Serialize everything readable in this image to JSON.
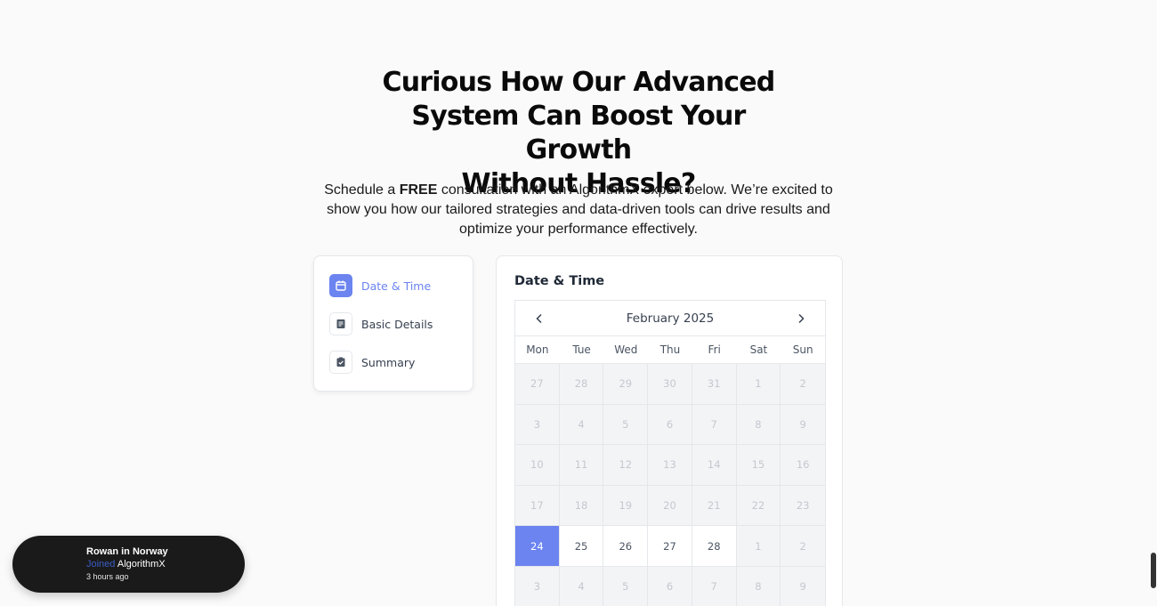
{
  "hero": {
    "title_lines": [
      "Curious How Our Advanced",
      "System Can Boost Your Growth",
      "Without Hassle?"
    ],
    "subtitle_pre": "Schedule a ",
    "subtitle_bold": "FREE",
    "subtitle_post": " consultation with an AlgorithmX expert below. We’re excited to show you how our tailored strategies and data-driven tools can drive results and optimize your performance effectively."
  },
  "steps": [
    {
      "label": "Date & Time",
      "icon": "calendar-icon",
      "active": true
    },
    {
      "label": "Basic Details",
      "icon": "document-icon",
      "active": false
    },
    {
      "label": "Summary",
      "icon": "clipboard-check-icon",
      "active": false
    }
  ],
  "calendar": {
    "title": "Date & Time",
    "month": "February 2025",
    "weekdays": [
      "Mon",
      "Tue",
      "Wed",
      "Thu",
      "Fri",
      "Sat",
      "Sun"
    ],
    "days": [
      {
        "d": "27",
        "s": "disabled"
      },
      {
        "d": "28",
        "s": "disabled"
      },
      {
        "d": "29",
        "s": "disabled"
      },
      {
        "d": "30",
        "s": "disabled"
      },
      {
        "d": "31",
        "s": "disabled"
      },
      {
        "d": "1",
        "s": "disabled"
      },
      {
        "d": "2",
        "s": "disabled"
      },
      {
        "d": "3",
        "s": "disabled"
      },
      {
        "d": "4",
        "s": "disabled"
      },
      {
        "d": "5",
        "s": "disabled"
      },
      {
        "d": "6",
        "s": "disabled"
      },
      {
        "d": "7",
        "s": "disabled"
      },
      {
        "d": "8",
        "s": "disabled"
      },
      {
        "d": "9",
        "s": "disabled"
      },
      {
        "d": "10",
        "s": "disabled"
      },
      {
        "d": "11",
        "s": "disabled"
      },
      {
        "d": "12",
        "s": "disabled"
      },
      {
        "d": "13",
        "s": "disabled"
      },
      {
        "d": "14",
        "s": "disabled"
      },
      {
        "d": "15",
        "s": "disabled"
      },
      {
        "d": "16",
        "s": "disabled"
      },
      {
        "d": "17",
        "s": "disabled"
      },
      {
        "d": "18",
        "s": "disabled"
      },
      {
        "d": "19",
        "s": "disabled"
      },
      {
        "d": "20",
        "s": "disabled"
      },
      {
        "d": "21",
        "s": "disabled"
      },
      {
        "d": "22",
        "s": "disabled"
      },
      {
        "d": "23",
        "s": "disabled"
      },
      {
        "d": "24",
        "s": "selected"
      },
      {
        "d": "25",
        "s": "available"
      },
      {
        "d": "26",
        "s": "available"
      },
      {
        "d": "27",
        "s": "available"
      },
      {
        "d": "28",
        "s": "available"
      },
      {
        "d": "1",
        "s": "disabled"
      },
      {
        "d": "2",
        "s": "disabled"
      },
      {
        "d": "3",
        "s": "disabled"
      },
      {
        "d": "4",
        "s": "disabled"
      },
      {
        "d": "5",
        "s": "disabled"
      },
      {
        "d": "6",
        "s": "disabled"
      },
      {
        "d": "7",
        "s": "disabled"
      },
      {
        "d": "8",
        "s": "disabled"
      },
      {
        "d": "9",
        "s": "disabled"
      }
    ]
  },
  "toast": {
    "name": "Rowan in Norway",
    "joined_word": "Joined",
    "company": "AlgorithmX",
    "time": "3 hours ago"
  },
  "colors": {
    "accent": "#6b84f0",
    "toast_bg": "#1a1a1a",
    "joined": "#3b5cc4"
  }
}
